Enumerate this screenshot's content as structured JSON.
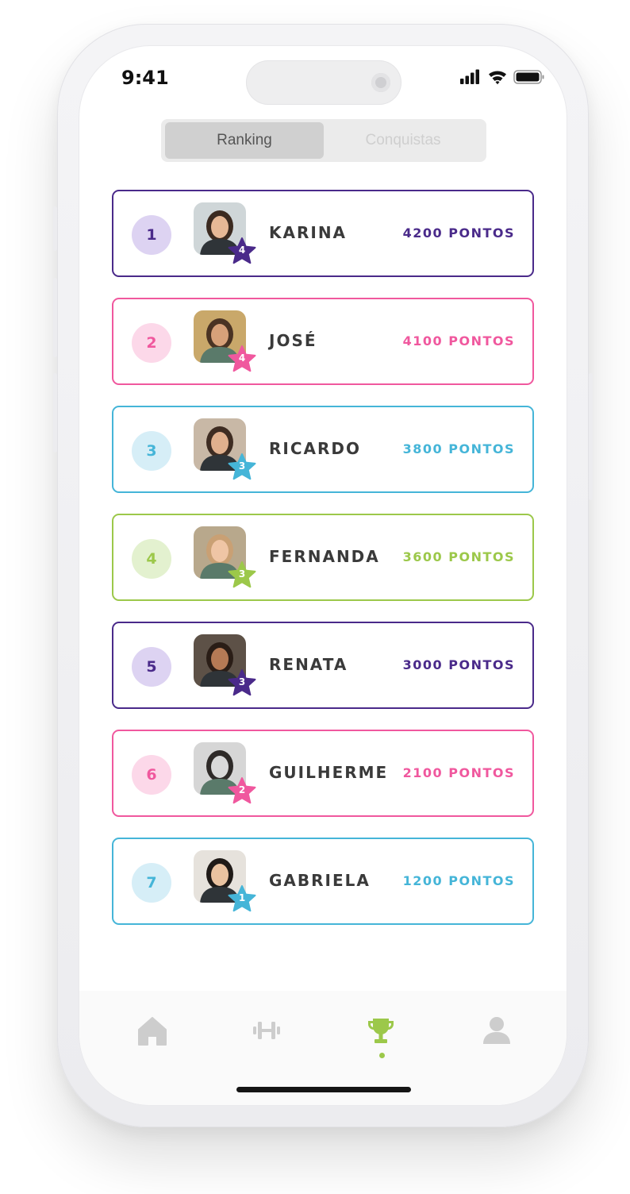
{
  "status_bar": {
    "time": "9:41"
  },
  "segmented": {
    "ranking": "Ranking",
    "conquistas": "Conquistas"
  },
  "colors": {
    "purple": "#4a2a8a",
    "pink": "#f0589e",
    "blue": "#45b5d8",
    "green": "#9cc84a"
  },
  "ranking": [
    {
      "rank": "1",
      "name": "KARINA",
      "points": "4200 PONTOS",
      "level": "4",
      "theme": "purple",
      "avatar": "woman-photo"
    },
    {
      "rank": "2",
      "name": "JOSÉ",
      "points": "4100 PONTOS",
      "level": "4",
      "theme": "pink",
      "avatar": "man-photo"
    },
    {
      "rank": "3",
      "name": "RICARDO",
      "points": "3800 PONTOS",
      "level": "3",
      "theme": "blue",
      "avatar": "man-photo"
    },
    {
      "rank": "4",
      "name": "FERNANDA",
      "points": "3600 PONTOS",
      "level": "3",
      "theme": "green",
      "avatar": "woman-photo"
    },
    {
      "rank": "5",
      "name": "RENATA",
      "points": "3000 PONTOS",
      "level": "3",
      "theme": "purple",
      "avatar": "woman-photo"
    },
    {
      "rank": "6",
      "name": "GUILHERME",
      "points": "2100 PONTOS",
      "level": "2",
      "theme": "pink",
      "avatar": "man-photo"
    },
    {
      "rank": "7",
      "name": "GABRIELA",
      "points": "1200 PONTOS",
      "level": "1",
      "theme": "blue",
      "avatar": "woman-photo"
    }
  ],
  "tabbar": [
    {
      "icon": "home-icon",
      "active": false
    },
    {
      "icon": "dumbbell-icon",
      "active": false
    },
    {
      "icon": "trophy-icon",
      "active": true
    },
    {
      "icon": "profile-icon",
      "active": false
    }
  ]
}
